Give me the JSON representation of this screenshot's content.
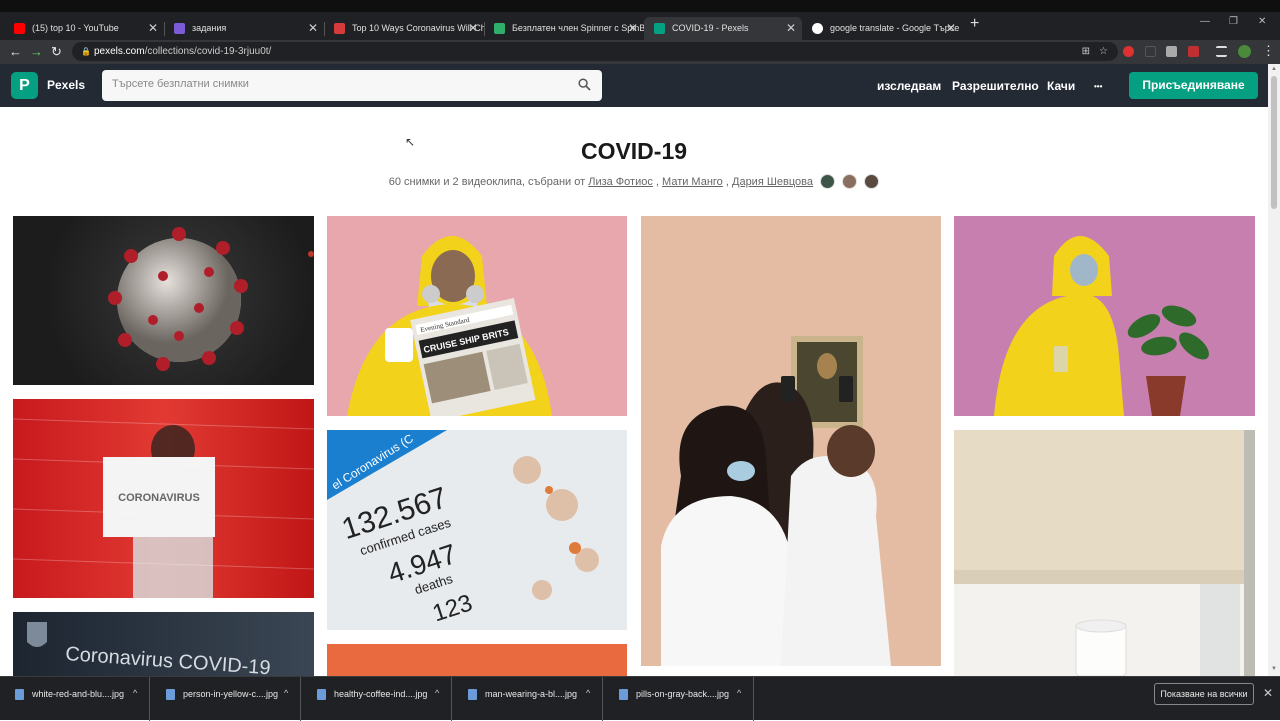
{
  "browser": {
    "tabs": [
      {
        "title": "(15) top 10 - YouTube",
        "favicon_color": "#ff0000",
        "active": false
      },
      {
        "title": "задания",
        "favicon_color": "#7b5bd6",
        "active": false
      },
      {
        "title": "Top 10 Ways Coronavirus Will Ch",
        "favicon_color": "#d63b3b",
        "active": false
      },
      {
        "title": "Безплатен член Spinner с SpinB",
        "favicon_color": "#2fae6b",
        "active": false
      },
      {
        "title": "COVID-19 - Pexels",
        "favicon_color": "#05a081",
        "active": true
      },
      {
        "title": "google translate - Google Търсе",
        "favicon_color": "#ffffff",
        "active": false
      }
    ],
    "new_tab_symbol": "+",
    "close_symbol": "✕",
    "url_host": "pexels.com",
    "url_path": "/collections/covid-19-3rjuu0t/",
    "window_controls": [
      "—",
      "❐",
      "✕"
    ]
  },
  "site": {
    "brand": "Pexels",
    "logo_letter": "P",
    "search_placeholder": "Търсете безплатни снимки",
    "nav": [
      "изследвам",
      "Разрешително",
      "Качи"
    ],
    "more": "•••",
    "join_label": "Присъединяване",
    "accent_color": "#05a081",
    "header_color": "#232a34"
  },
  "collection": {
    "title": "COVID-19",
    "summary_prefix": "60 снимки и 2 видеоклипа, събрани от",
    "curators": [
      "Лиза Фотиос",
      "Мати Манго",
      "Дария Шевцова"
    ],
    "separator": ","
  },
  "photos": [
    {
      "alt": "coronavirus model",
      "caption": ""
    },
    {
      "alt": "person in yellow suit reading newspaper",
      "caption": ""
    },
    {
      "alt": "people in masks photographing painting",
      "caption": ""
    },
    {
      "alt": "person in yellow suit with plant",
      "caption": ""
    },
    {
      "alt": "person holding coronavirus sign",
      "caption": "CORONAVIRUS"
    },
    {
      "alt": "coronavirus statistics screen",
      "caption": "132.567"
    },
    {
      "alt": "window blinds",
      "caption": ""
    },
    {
      "alt": "coronavirus covid-19 banner",
      "caption": "Coronavirus COVID-19"
    },
    {
      "alt": "orange photo",
      "caption": ""
    }
  ],
  "photo_text": {
    "newspaper": "Evening Standard",
    "headline": "CRUISE SHIP BRITS",
    "label1": "confirmed cases",
    "num2": "4.947",
    "label2": "deaths",
    "num3": "123",
    "map_title": "el Coronavirus (C"
  },
  "downloads": {
    "items": [
      "white-red-and-blu....jpg",
      "person-in-yellow-c....jpg",
      "healthy-coffee-ind....jpg",
      "man-wearing-a-bl....jpg",
      "pills-on-gray-back....jpg"
    ],
    "show_all": "Показване на всички",
    "chevron": "^",
    "close": "✕"
  }
}
